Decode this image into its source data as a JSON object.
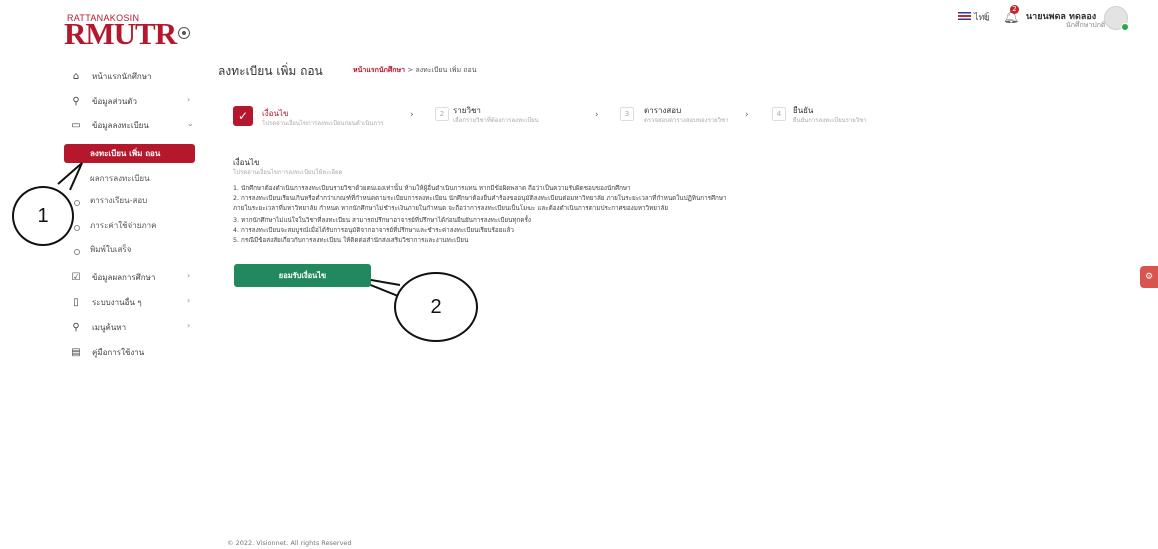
{
  "brand": {
    "top": "RATTANAKOSIN",
    "main": "RMUTR",
    "color": "#b5182d"
  },
  "header": {
    "lang": "ไทย",
    "notification_count": "2",
    "user_name": "นายนพดล ทดลอง",
    "user_role": "นักศึกษาปกติ"
  },
  "sidebar": {
    "items": [
      {
        "label": "หน้าแรกนักศึกษา",
        "icon": "home-icon"
      },
      {
        "label": "ข้อมูลส่วนตัว",
        "icon": "user-icon"
      },
      {
        "label": "ข้อมูลลงทะเบียน",
        "icon": "book-icon"
      }
    ],
    "active": "ลงทะเบียน เพิ่ม ถอน",
    "subitems": [
      "ผลการลงทะเบียน",
      "ตารางเรียน-สอบ",
      "ภาระค่าใช้จ่ายภาค",
      "พิมพ์ใบเสร็จ"
    ],
    "items2": [
      {
        "label": "ข้อมูลผลการศึกษา",
        "icon": "check-square-icon"
      },
      {
        "label": "ระบบงานอื่น ๆ",
        "icon": "clipboard-icon"
      },
      {
        "label": "เมนูค้นหา",
        "icon": "search-icon"
      },
      {
        "label": "คู่มือการใช้งาน",
        "icon": "file-icon"
      }
    ]
  },
  "main": {
    "title": "ลงทะเบียน เพิ่ม ถอน",
    "breadcrumb_home": "หน้าแรกนักศึกษา",
    "breadcrumb_sep": ">",
    "breadcrumb_current": "ลงทะเบียน เพิ่ม ถอน",
    "steps": [
      {
        "num": "",
        "title": "เงื่อนไข",
        "desc": "โปรดอ่านเงื่อนไขการลงทะเบียนก่อนดำเนินการ"
      },
      {
        "num": "2",
        "title": "รายวิชา",
        "desc": "เลือกรายวิชาที่ต้องการลงทะเบียน"
      },
      {
        "num": "3",
        "title": "ตารางสอบ",
        "desc": "ตรวจสอบตารางสอบของรายวิชา"
      },
      {
        "num": "4",
        "title": "ยืนยัน",
        "desc": "ยืนยันการลงทะเบียนรายวิชา"
      }
    ],
    "section_title": "เงื่อนไข",
    "section_sub": "โปรดอ่านเงื่อนไขการลงทะเบียนให้ละเอียด",
    "conditions": [
      "1. นักศึกษาต้องดำเนินการลงทะเบียนรายวิชาด้วยตนเองเท่านั้น ห้ามให้ผู้อื่นดำเนินการแทน หากมีข้อผิดพลาด ถือว่าเป็นความรับผิดชอบของนักศึกษา",
      "2. การลงทะเบียนเรียนเกินหรือต่ำกว่าเกณฑ์ที่กำหนดตามระเบียบการลงทะเบียน นักศึกษาต้องยื่นคำร้องขออนุมัติลงทะเบียนต่อมหาวิทยาลัย ภายในระยะเวลาที่กำหนดในปฏิทินการศึกษา",
      "ภายในระยะเวลาที่มหาวิทยาลัย กำหนด หากนักศึกษาไม่ชำระเงินภายในกำหนด จะถือว่าการลงทะเบียนเป็นโมฆะ และต้องดำเนินการตามประกาศของมหาวิทยาลัย",
      "3. หากนักศึกษาไม่แน่ใจในวิชาที่ลงทะเบียน สามารถปรึกษาอาจารย์ที่ปรึกษาได้ก่อนยืนยันการลงทะเบียนทุกครั้ง",
      "4. การลงทะเบียนจะสมบูรณ์เมื่อได้รับการอนุมัติจากอาจารย์ที่ปรึกษาและชำระค่าลงทะเบียนเรียบร้อยแล้ว",
      "5. กรณีมีข้อสงสัยเกี่ยวกับการลงทะเบียน ให้ติดต่อสำนักส่งเสริมวิชาการและงานทะเบียน"
    ],
    "accept_button": "ยอมรับเงื่อนไข"
  },
  "annotations": {
    "one": "1",
    "two": "2"
  },
  "footer": "© 2022. Visionnet. All rights Reserved",
  "colors": {
    "accent": "#b5182d",
    "button": "#22895f"
  }
}
